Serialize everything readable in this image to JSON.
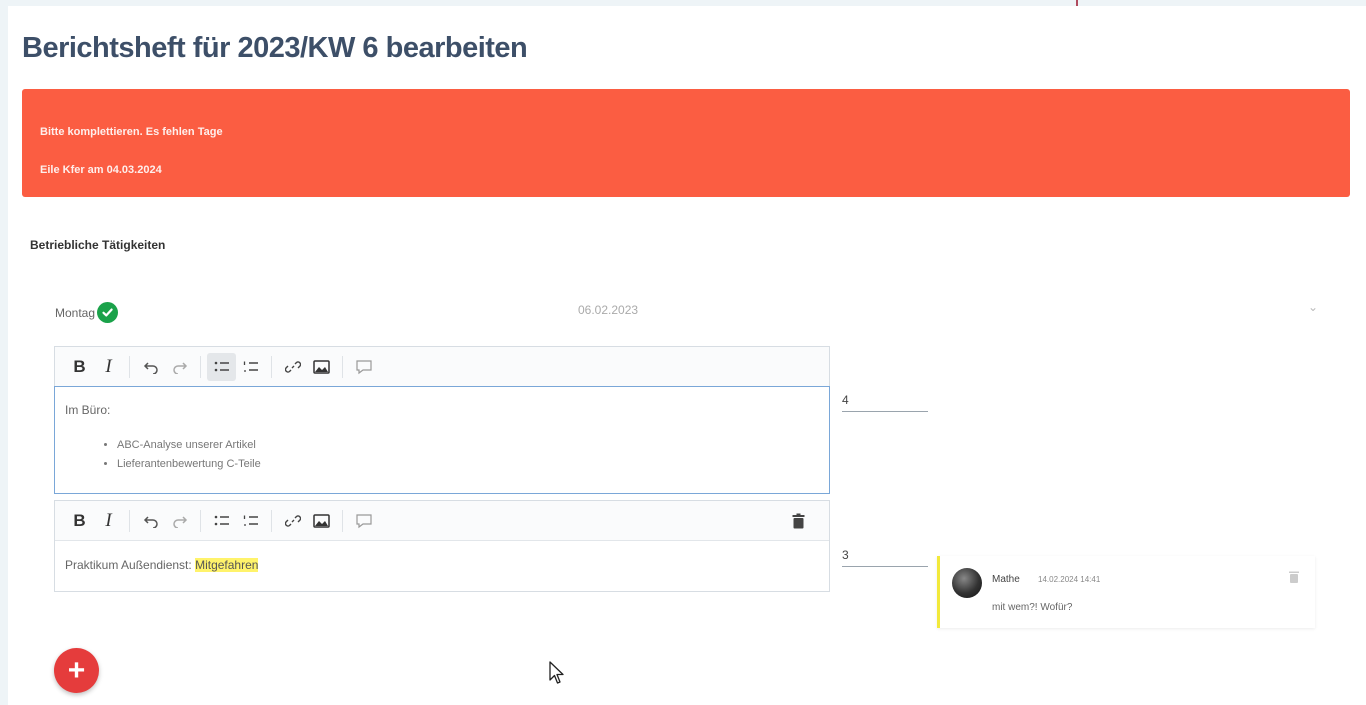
{
  "page": {
    "title": "Berichtsheft für 2023/KW 6 bearbeiten"
  },
  "alert": {
    "line1": "Bitte komplettieren. Es fehlen Tage",
    "line2": "Eile Kfer am 04.03.2024"
  },
  "section": {
    "label": "Betriebliche Tätigkeiten"
  },
  "day": {
    "name": "Montag",
    "date": "06.02.2023",
    "status": "complete"
  },
  "editor1": {
    "content_title": "Im Büro:",
    "bullets": [
      "ABC-Analyse unserer Artikel",
      "Lieferantenbewertung C-Teile"
    ],
    "hours": "4"
  },
  "editor2": {
    "content_prefix": "Praktikum Außendienst:",
    "content_highlight": "Mitgefahren",
    "hours": "3"
  },
  "comment": {
    "author": "Mathe",
    "time": "14.02.2024 14:41",
    "text": "mit wem?! Wofür?"
  },
  "colors": {
    "alert_bg": "#fb5d42",
    "title": "#3d4f68",
    "check": "#1aa24a",
    "fab": "#e53c3c",
    "comment_accent": "#f2e93b",
    "highlight": "#fff36b"
  },
  "icons": {
    "toolbar": [
      "bold-icon",
      "italic-icon",
      "undo-icon",
      "redo-icon",
      "bullet-list-icon",
      "numbered-list-icon",
      "link-icon",
      "image-icon",
      "comment-icon"
    ],
    "delete": "trash-icon",
    "add": "plus-icon"
  }
}
